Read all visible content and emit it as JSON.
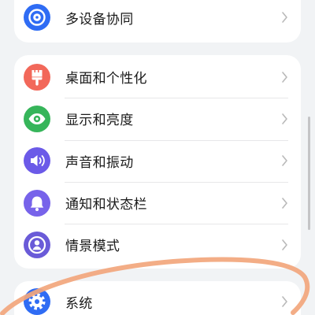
{
  "groups": [
    {
      "items": [
        {
          "label": "多设备协同",
          "icon": "multi-device-icon",
          "icon_color": "#2f6cf4"
        }
      ]
    },
    {
      "items": [
        {
          "label": "桌面和个性化",
          "icon": "paintbrush-icon",
          "icon_color": "#f2685a"
        },
        {
          "label": "显示和亮度",
          "icon": "eye-icon",
          "icon_color": "#36b55a"
        },
        {
          "label": "声音和振动",
          "icon": "speaker-icon",
          "icon_color": "#6b5ae8"
        },
        {
          "label": "通知和状态栏",
          "icon": "bell-icon",
          "icon_color": "#7763ea"
        },
        {
          "label": "情景模式",
          "icon": "person-circle-icon",
          "icon_color": "#6a5bd8"
        }
      ]
    },
    {
      "items": [
        {
          "label": "系统",
          "icon": "gear-icon",
          "icon_color": "#2f6cf4"
        }
      ]
    }
  ],
  "theme": {
    "background": "#f1f3f5",
    "card": "#ffffff",
    "text": "#1a1a1a",
    "chevron": "#b9b9b9",
    "divider": "#e7e7e9",
    "scrollbar": "#c4c4c6",
    "annotation": "#f2a67c"
  }
}
